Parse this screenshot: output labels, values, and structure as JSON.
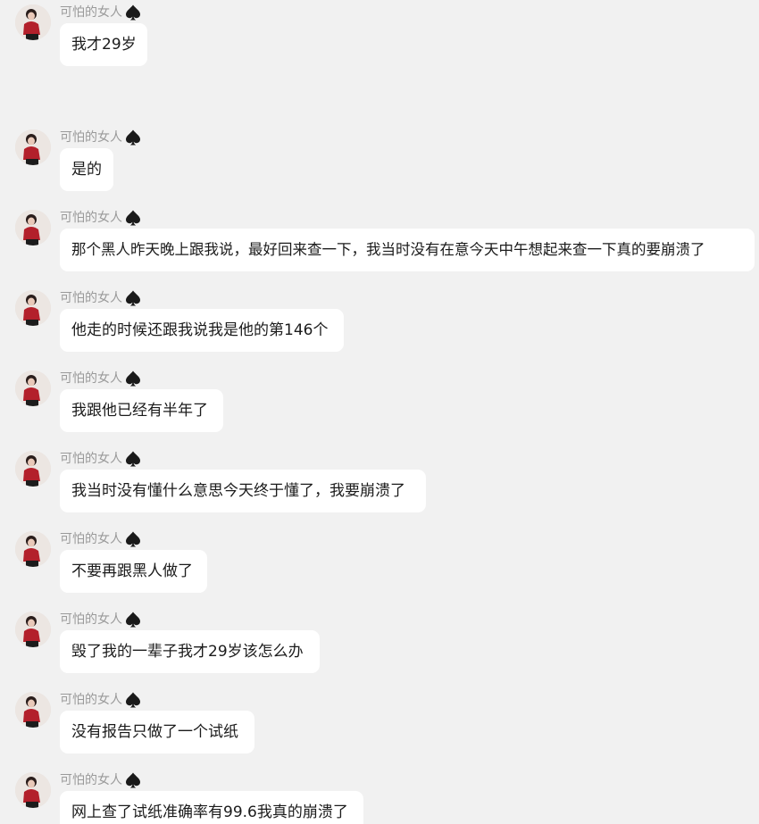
{
  "sender_name": "可怕的女人",
  "messages": [
    {
      "text": "我才29岁"
    },
    {
      "text": "是的"
    },
    {
      "text": "那个黑人昨天晚上跟我说，最好回来查一下，我当时没有在意今天中午想起来查一下真的要崩溃了"
    },
    {
      "text": "他走的时候还跟我说我是他的第146个"
    },
    {
      "text": "我跟他已经有半年了"
    },
    {
      "text": "我当时没有懂什么意思今天终于懂了，我要崩溃了"
    },
    {
      "text": "不要再跟黑人做了"
    },
    {
      "text": "毁了我的一辈子我才29岁该怎么办"
    },
    {
      "text": "没有报告只做了一个试纸"
    },
    {
      "text": "网上查了试纸准确率有99.6我真的崩溃了"
    }
  ]
}
